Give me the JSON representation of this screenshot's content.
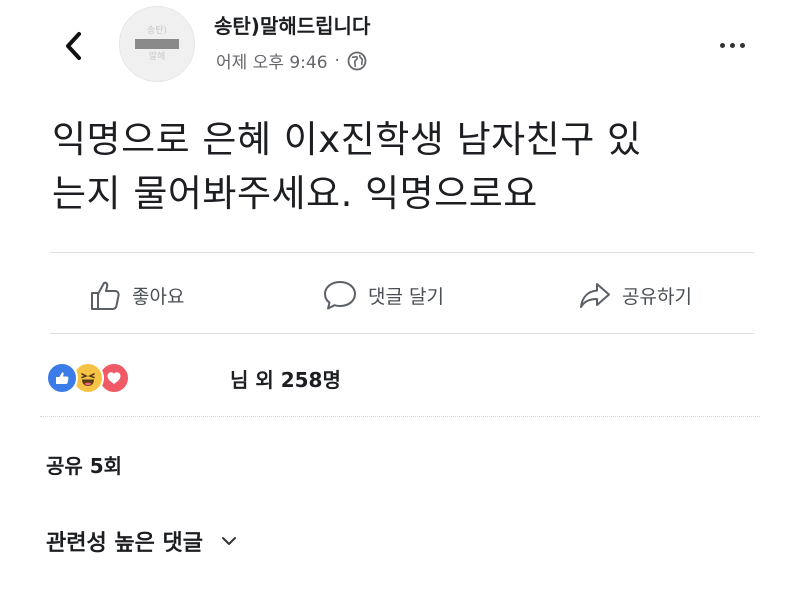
{
  "header": {
    "page_name": "송탄)말해드립니다",
    "time": "어제 오후 9:46",
    "separator": "·",
    "avatar_text_top": "송탄)",
    "avatar_text_bottom": "말해"
  },
  "post": {
    "lines": [
      "익명으로 은혜 이x진학생 남자친구 있",
      "는지 물어봐주세요. 익명으로요"
    ]
  },
  "actions": {
    "like_label": "좋아요",
    "comment_label": "댓글 달기",
    "share_label": "공유하기"
  },
  "reactions": {
    "icons": [
      "like",
      "haha",
      "love"
    ],
    "count_text": "님 외 258명"
  },
  "shares": {
    "text": "공유 5회"
  },
  "comments": {
    "sort_label": "관련성 높은 댓글"
  },
  "colors": {
    "like_blue": "#3b7ce8",
    "haha_yellow": "#f6c444",
    "love_red": "#f05a67",
    "text_dark": "#1c1e21",
    "text_muted": "#65676b"
  }
}
